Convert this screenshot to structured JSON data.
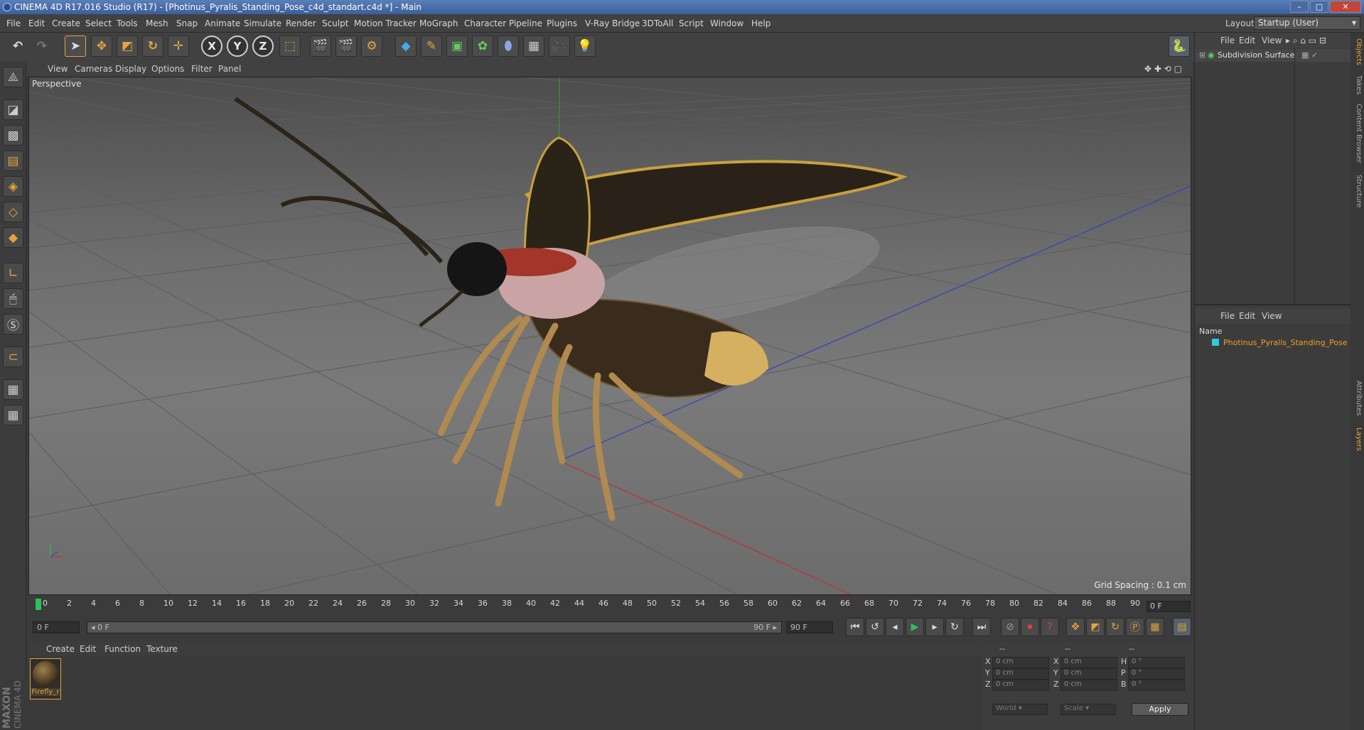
{
  "window": {
    "title": "CINEMA 4D R17.016 Studio (R17) - [Photinus_Pyralis_Standing_Pose_c4d_standart.c4d *] - Main",
    "controls": [
      "–",
      "□",
      "✕"
    ]
  },
  "menubar": {
    "items": [
      "File",
      "Edit",
      "Create",
      "Select",
      "Tools",
      "Mesh",
      "Snap",
      "Animate",
      "Simulate",
      "Render",
      "Sculpt",
      "Motion Tracker",
      "MoGraph",
      "Character",
      "Pipeline",
      "Plugins",
      "V-Ray Bridge",
      "3DToAll",
      "Script",
      "Window",
      "Help"
    ],
    "layout_label": "Layout:",
    "layout_value": "Startup (User)"
  },
  "toolbar": {
    "axis_labels": [
      "X",
      "Y",
      "Z"
    ]
  },
  "viewport": {
    "menu": [
      "View",
      "Cameras",
      "Display",
      "Options",
      "Filter",
      "Panel"
    ],
    "camera_label": "Perspective",
    "grid_spacing": "Grid Spacing : 0.1 cm"
  },
  "timeline": {
    "ticks": [
      "0",
      "2",
      "4",
      "6",
      "8",
      "10",
      "12",
      "14",
      "16",
      "18",
      "20",
      "22",
      "24",
      "26",
      "28",
      "30",
      "32",
      "34",
      "36",
      "38",
      "40",
      "42",
      "44",
      "46",
      "48",
      "50",
      "52",
      "54",
      "56",
      "58",
      "60",
      "62",
      "64",
      "66",
      "68",
      "70",
      "72",
      "74",
      "76",
      "78",
      "80",
      "82",
      "84",
      "86",
      "88",
      "90"
    ],
    "current_frame_right": "0 F"
  },
  "transport": {
    "start_field": "0 F",
    "range_start": "◂ 0 F",
    "range_end": "90 F ▸",
    "end_field": "90 F"
  },
  "material_manager": {
    "menu": [
      "Create",
      "Edit",
      "Function",
      "Texture"
    ],
    "material_name": "Firefly_r"
  },
  "coordinates": {
    "headers": [
      "--",
      "--",
      "--"
    ],
    "rows": [
      {
        "l1": "X",
        "v1": "0 cm",
        "l2": "X",
        "v2": "0 cm",
        "l3": "H",
        "v3": "0 °"
      },
      {
        "l1": "Y",
        "v1": "0 cm",
        "l2": "Y",
        "v2": "0 cm",
        "l3": "P",
        "v3": "0 °"
      },
      {
        "l1": "Z",
        "v1": "0 cm",
        "l2": "Z",
        "v2": "0 cm",
        "l3": "B",
        "v3": "0 °"
      }
    ],
    "mode1": "World",
    "mode2": "Scale",
    "apply_label": "Apply"
  },
  "object_manager": {
    "menu": [
      "File",
      "Edit",
      "View"
    ],
    "object_name": "Subdivision Surface"
  },
  "layer_manager": {
    "menu": [
      "File",
      "Edit",
      "View"
    ],
    "column_header": "Name",
    "layer_name": "Photinus_Pyralis_Standing_Pose"
  },
  "side_tabs": [
    "Objects",
    "Takes",
    "Content Browser",
    "Structure",
    "Attributes",
    "Layers"
  ],
  "brand": {
    "line1": "MAXON",
    "line2": "CINEMA 4D"
  },
  "colors": {
    "accent_orange": "#e5a43b",
    "layer_cyan": "#35c6e0",
    "layer_text": "#f0a020"
  }
}
